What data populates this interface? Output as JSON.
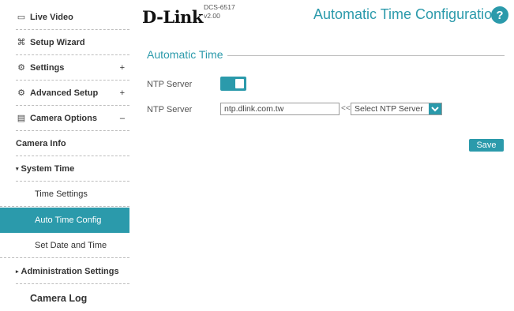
{
  "header": {
    "logo": "D-Link",
    "model": "DCS-6517",
    "version": "v2.00",
    "title": "Automatic Time Configuration",
    "help_icon": "?"
  },
  "sidebar": {
    "items": [
      {
        "label": "Live Video",
        "icon": "video-icon"
      },
      {
        "label": "Setup Wizard",
        "icon": "wand-icon"
      },
      {
        "label": "Settings",
        "icon": "gear-icon",
        "toggle": "+"
      },
      {
        "label": "Advanced Setup",
        "icon": "advanced-gear-icon",
        "toggle": "+"
      },
      {
        "label": "Camera Options",
        "icon": "document-icon",
        "toggle": "–"
      },
      {
        "label": "Camera Info"
      },
      {
        "label": "System Time",
        "caret": "▾"
      },
      {
        "label": "Time Settings"
      },
      {
        "label": "Auto Time Config",
        "active": true
      },
      {
        "label": "Set Date and Time"
      },
      {
        "label": "Administration Settings",
        "caret": "▸"
      },
      {
        "label": "Camera Log"
      }
    ]
  },
  "main": {
    "section_title": "Automatic Time",
    "ntp_toggle_label": "NTP Server",
    "ntp_toggle_state": "on",
    "ntp_server_label": "NTP Server",
    "ntp_server_value": "ntp.dlink.com.tw",
    "arrows": "<<",
    "select_value": "Select NTP Server",
    "save_label": "Save"
  },
  "colors": {
    "accent": "#2b9aab"
  }
}
